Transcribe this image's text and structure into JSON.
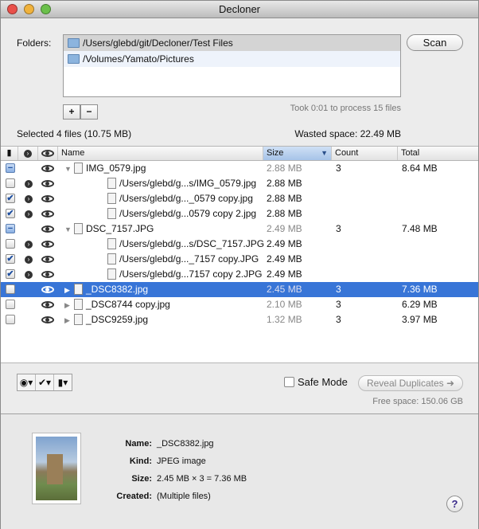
{
  "window": {
    "title": "Decloner"
  },
  "folders": {
    "label": "Folders:",
    "items": [
      "/Users/glebd/git/Decloner/Test Files",
      "/Volumes/Yamato/Pictures"
    ],
    "add": "+",
    "remove": "−"
  },
  "scan_label": "Scan",
  "process_status": "Took 0:01 to process 15 files",
  "selected_summary": "Selected 4 files (10.75 MB)",
  "wasted_space": "Wasted space: 22.49 MB",
  "table": {
    "columns": {
      "name": "Name",
      "size": "Size",
      "count": "Count",
      "total": "Total"
    },
    "rows": [
      {
        "check": "mixed",
        "arrow": false,
        "level": 0,
        "tri": "▼",
        "name": "IMG_0579.jpg",
        "size": "2.88 MB",
        "count": "3",
        "total": "8.64 MB"
      },
      {
        "check": "off",
        "arrow": true,
        "level": 1,
        "name": "/Users/glebd/g...s/IMG_0579.jpg",
        "size": "2.88 MB",
        "count": "",
        "total": ""
      },
      {
        "check": "on",
        "arrow": true,
        "level": 1,
        "name": "/Users/glebd/g..._0579 copy.jpg",
        "size": "2.88 MB",
        "count": "",
        "total": ""
      },
      {
        "check": "on",
        "arrow": true,
        "level": 1,
        "name": "/Users/glebd/g...0579 copy 2.jpg",
        "size": "2.88 MB",
        "count": "",
        "total": ""
      },
      {
        "check": "mixed",
        "arrow": false,
        "level": 0,
        "tri": "▼",
        "name": "DSC_7157.JPG",
        "size": "2.49 MB",
        "count": "3",
        "total": "7.48 MB"
      },
      {
        "check": "off",
        "arrow": true,
        "level": 1,
        "name": "/Users/glebd/g...s/DSC_7157.JPG",
        "size": "2.49 MB",
        "count": "",
        "total": ""
      },
      {
        "check": "on",
        "arrow": true,
        "level": 1,
        "name": "/Users/glebd/g..._7157 copy.JPG",
        "size": "2.49 MB",
        "count": "",
        "total": ""
      },
      {
        "check": "on",
        "arrow": true,
        "level": 1,
        "name": "/Users/glebd/g...7157 copy 2.JPG",
        "size": "2.49 MB",
        "count": "",
        "total": ""
      },
      {
        "check": "off",
        "arrow": false,
        "level": 0,
        "tri": "▶",
        "name": "_DSC8382.jpg",
        "size": "2.45 MB",
        "count": "3",
        "total": "7.36 MB",
        "selected": true
      },
      {
        "check": "off",
        "arrow": false,
        "level": 0,
        "tri": "▶",
        "name": "_DSC8744 copy.jpg",
        "size": "2.10 MB",
        "count": "3",
        "total": "6.29 MB"
      },
      {
        "check": "off",
        "arrow": false,
        "level": 0,
        "tri": "▶",
        "name": "_DSC9259.jpg",
        "size": "1.32 MB",
        "count": "3",
        "total": "3.97 MB"
      }
    ]
  },
  "safe_mode_label": "Safe Mode",
  "reveal_label": "Reveal Duplicates",
  "free_space": "Free space: 150.06 GB",
  "info": {
    "name_label": "Name:",
    "name": "_DSC8382.jpg",
    "kind_label": "Kind:",
    "kind": "JPEG image",
    "size_label": "Size:",
    "size": "2.45 MB × 3 = 7.36 MB",
    "created_label": "Created:",
    "created": "(Multiple files)"
  },
  "help": "?"
}
